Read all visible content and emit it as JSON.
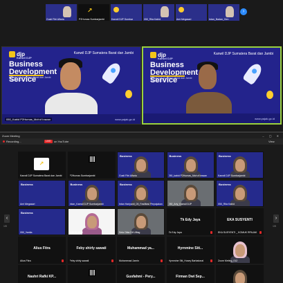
{
  "strip": {
    "tiles": [
      {
        "name": "Gusti Fitri Alfaria",
        "type": "person"
      },
      {
        "name": "P2Humas Sumbarjambi",
        "type": "djp"
      },
      {
        "name": "Kanwil DJP Sumbar",
        "type": "banner"
      },
      {
        "name": "050_Rita Kabid",
        "type": "person"
      },
      {
        "name": "Ami Megasari",
        "type": "banner"
      },
      {
        "name": "Intan_Badan_Gen",
        "type": "person"
      }
    ],
    "next_icon": "›"
  },
  "speakers": [
    {
      "brand": "djp",
      "brand_sub": "Kanwil DJP",
      "header": "Kanwil DJP Sumatera Barat dan Jambi",
      "title": "Business Development Service",
      "subtitle": "Kanwil DJP Sumatera Barat dan Jambi Tahun 2022",
      "website": "www.pajak.go.id",
      "caption": "050_Kabid P2Humas_Ma'ruf Irawan"
    },
    {
      "brand": "djp",
      "brand_sub": "Kanwil DJP",
      "header": "Kanwil DJP Sumatera Barat dan Jambi",
      "title": "Business Development Service",
      "subtitle": "Kanwil DJP Sumatera Barat dan Jambi Tahun 2022",
      "website": "www.pajak.go.id",
      "caption": ""
    }
  ],
  "titlebar": {
    "title": "Zoom Meeting",
    "controls": "– ▢ ✕"
  },
  "toolbar": {
    "recording": "Recording...",
    "live": "LIVE",
    "live_on": "on YouTube",
    "view": "View"
  },
  "gallery": {
    "tiles": [
      {
        "name": "Kanwil DJP Sumatera Barat dan Jambi",
        "style": "djp",
        "big": ""
      },
      {
        "name": "P2Humas Sumbarjambi",
        "style": "black-qr",
        "big": ""
      },
      {
        "name": "Gusti Fitri Alfaria",
        "style": "blue-person",
        "big": ""
      },
      {
        "name": "050_kabid P2Humas_Ma'ruf Irawan",
        "style": "blue-person",
        "big": ""
      },
      {
        "name": "Kanwil DJP Sumbarjambi",
        "style": "blue-person",
        "big": ""
      },
      {
        "name": "Ami Megasari",
        "style": "blue",
        "big": ""
      },
      {
        "name": "Intan_Kanwil DJP Sumbarjambi",
        "style": "blue-person",
        "big": ""
      },
      {
        "name": "Intan Hariyanti_05_Fasilitasi Perpajakan",
        "style": "blue-person",
        "big": ""
      },
      {
        "name": "050_Ariy_Kanwil DJP",
        "style": "room",
        "big": ""
      },
      {
        "name": "050_Rita Kabid",
        "style": "blue-person",
        "big": ""
      },
      {
        "name": "050_Vanita",
        "style": "blue",
        "big": ""
      },
      {
        "name": "AINUR AFNI",
        "style": "white-person",
        "big": ""
      },
      {
        "name": "Sela Okta Dil Ulfiag",
        "style": "room",
        "big": ""
      },
      {
        "name": "Tk Edy Jaya",
        "style": "black",
        "big": "Tk Edy Jaya"
      },
      {
        "name": "EKA SUSYENTI _ KOMUK RPAJAK",
        "style": "black",
        "big": "EKA SUSYENTI"
      },
      {
        "name": "Alius Fitra",
        "style": "black",
        "big": "Alius Fitra"
      },
      {
        "name": "Feby shirly sawati",
        "style": "black",
        "big": "Feby shirly sawati"
      },
      {
        "name": "Muhammad Jamin",
        "style": "black",
        "big": "Muhammad ya..."
      },
      {
        "name": "Hyrnmine Siti_Hosey Barbatonal",
        "style": "black",
        "big": "Hyrnmine Siti..."
      },
      {
        "name": "Zoom Meting_012",
        "style": "pink-avatar",
        "big": ""
      },
      {
        "name": "Nashri Rafki",
        "style": "black",
        "big": "Nashri Rafki KP..."
      },
      {
        "name": "",
        "style": "black-qr",
        "big": ""
      },
      {
        "name": "Gusfahmi - Pery...",
        "style": "black",
        "big": "Gusfahmi - Pery..."
      },
      {
        "name": "Firman Dwi Sep...",
        "style": "black",
        "big": "Firman Dwi Sep..."
      },
      {
        "name": "",
        "style": "black-person",
        "big": ""
      }
    ],
    "page_left": "1/5",
    "page_right": "1/5",
    "prev_icon": "‹",
    "next_icon": "›"
  },
  "colors": {
    "banner_blue": "#252a8c",
    "active_border": "#9bd23c",
    "djp_yellow": "#f3c419",
    "live_red": "#e02828",
    "zoom_blue": "#2d8cff"
  }
}
